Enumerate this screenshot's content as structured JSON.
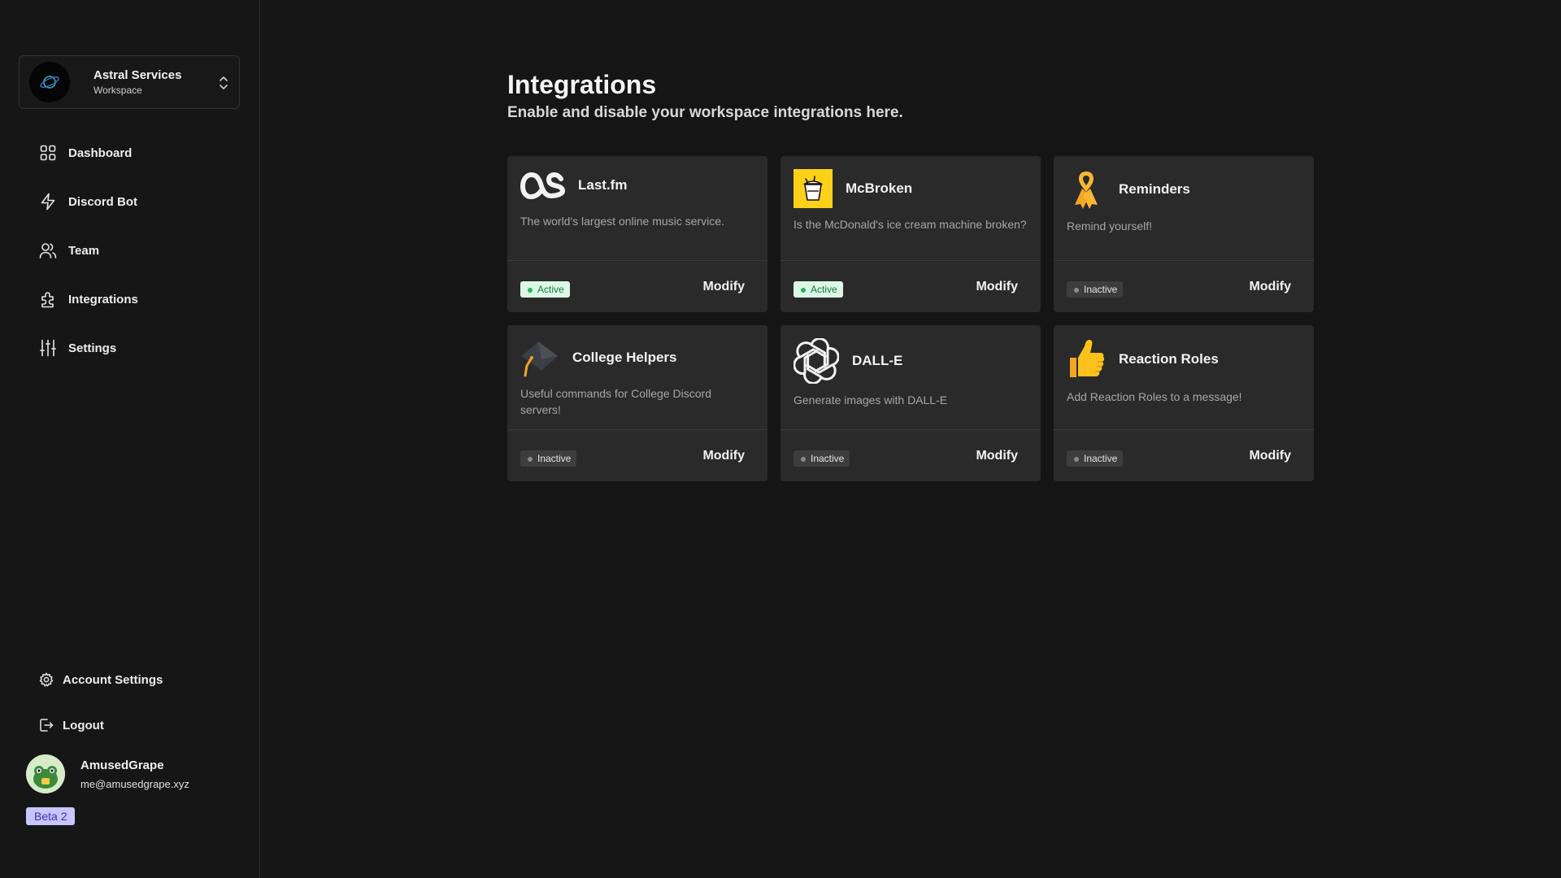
{
  "workspace": {
    "name": "Astral Services",
    "subtitle": "Workspace"
  },
  "nav": [
    {
      "label": "Dashboard",
      "icon": "grid-icon"
    },
    {
      "label": "Discord Bot",
      "icon": "lightning-icon"
    },
    {
      "label": "Team",
      "icon": "users-icon"
    },
    {
      "label": "Integrations",
      "icon": "puzzle-icon"
    },
    {
      "label": "Settings",
      "icon": "sliders-icon"
    }
  ],
  "account": {
    "settings_label": "Account Settings",
    "logout_label": "Logout"
  },
  "user": {
    "name": "AmusedGrape",
    "email": "me@amusedgrape.xyz",
    "badge": "Beta 2"
  },
  "page": {
    "title": "Integrations",
    "subtitle": "Enable and disable your workspace integrations here."
  },
  "integrations": [
    {
      "name": "Last.fm",
      "description": "The world's largest online music service.",
      "status": "Active",
      "action": "Modify",
      "icon": "lastfm-logo"
    },
    {
      "name": "McBroken",
      "description": "Is the McDonald's ice cream machine broken?",
      "status": "Active",
      "action": "Modify",
      "icon": "ice-cream-icon"
    },
    {
      "name": "Reminders",
      "description": "Remind yourself!",
      "status": "Inactive",
      "action": "Modify",
      "icon": "ribbon-icon"
    },
    {
      "name": "College Helpers",
      "description": "Useful commands for College Discord servers!",
      "status": "Inactive",
      "action": "Modify",
      "icon": "graduation-cap-icon"
    },
    {
      "name": "DALL-E",
      "description": "Generate images with DALL-E",
      "status": "Inactive",
      "action": "Modify",
      "icon": "openai-logo"
    },
    {
      "name": "Reaction Roles",
      "description": "Add Reaction Roles to a message!",
      "status": "Inactive",
      "action": "Modify",
      "icon": "thumbs-up-icon"
    }
  ],
  "colors": {
    "background": "#151515",
    "card": "#2a2a2a",
    "active_badge": "#dcf7e6",
    "inactive_badge": "#3d3d3d",
    "beta_badge": "#c9c6ff"
  }
}
